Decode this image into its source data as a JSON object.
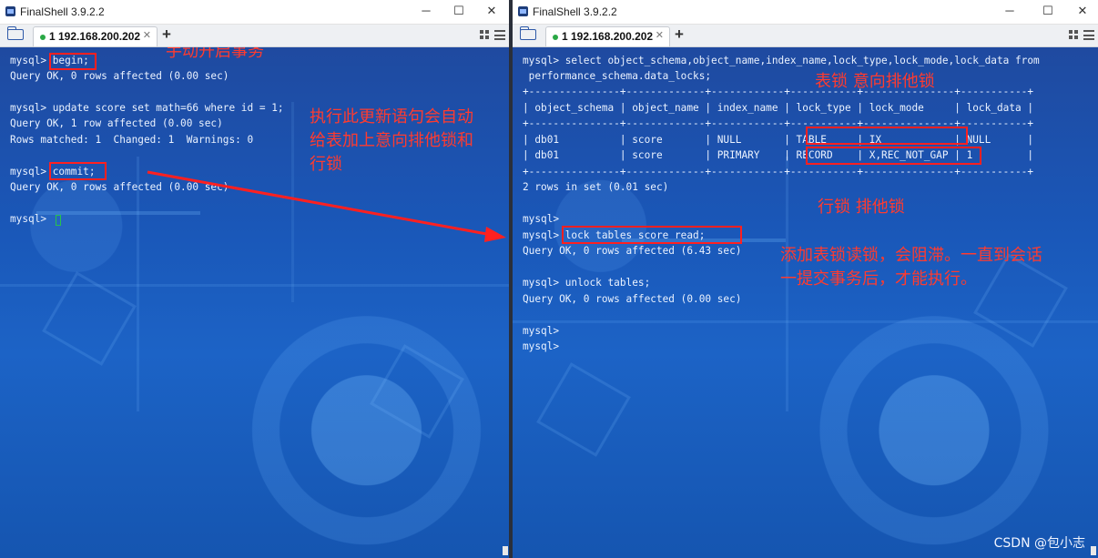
{
  "left_window": {
    "title": "FinalShell 3.9.2.2",
    "tab_label": "1 192.168.200.202",
    "terminal_lines": [
      "mysql> begin;",
      "Query OK, 0 rows affected (0.00 sec)",
      "",
      "mysql> update score set math=66 where id = 1;",
      "Query OK, 1 row affected (0.00 sec)",
      "Rows matched: 1  Changed: 1  Warnings: 0",
      "",
      "mysql> commit;",
      "Query OK, 0 rows affected (0.00 sec)",
      "",
      "mysql> "
    ],
    "annotation_begin": "手动开启事务",
    "annotation_update": "执行此更新语句会自动\n给表加上意向排他锁和\n行锁"
  },
  "right_window": {
    "title": "FinalShell 3.9.2.2",
    "tab_label": "1 192.168.200.202",
    "terminal_lines": [
      "mysql> select object_schema,object_name,index_name,lock_type,lock_mode,lock_data from",
      " performance_schema.data_locks;",
      "+---------------+-------------+------------+-----------+---------------+-----------+",
      "| object_schema | object_name | index_name | lock_type | lock_mode     | lock_data |",
      "+---------------+-------------+------------+-----------+---------------+-----------+",
      "| db01          | score       | NULL       | TABLE     | IX            | NULL      |",
      "| db01          | score       | PRIMARY    | RECORD    | X,REC_NOT_GAP | 1         |",
      "+---------------+-------------+------------+-----------+---------------+-----------+",
      "2 rows in set (0.01 sec)",
      "",
      "mysql>",
      "mysql> lock tables score read;",
      "Query OK, 0 rows affected (6.43 sec)",
      "",
      "mysql> unlock tables;",
      "Query OK, 0 rows affected (0.00 sec)",
      "",
      "mysql>",
      "mysql>"
    ],
    "annotation_table_lock": "表锁 意向排他锁",
    "annotation_row_lock": "行锁 排他锁",
    "annotation_read_lock": "添加表锁读锁，会阻滞。一直到会话\n一提交事务后，才能执行。"
  },
  "watermark": "CSDN @包小志",
  "colors": {
    "annotation": "#ff3b2f",
    "terminal_text": "#eaf2ff",
    "terminal_bg": "#1c5ab8"
  }
}
